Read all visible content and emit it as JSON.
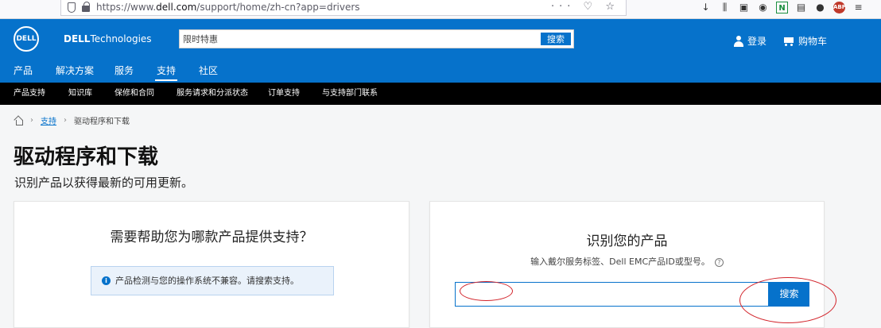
{
  "browser": {
    "url_prefix": "https://www.",
    "url_domain": "dell.com",
    "url_path": "/support/home/zh-cn?app=drivers",
    "url_tools": "··· ♡ ☆",
    "ext_n_label": "N",
    "ext_abp_label": "ABP"
  },
  "header": {
    "logo_text": "DELL",
    "brand_bold": "DELL",
    "brand_rest": "Technologies",
    "search_value": "限时特惠",
    "search_button": "搜索",
    "login": "登录",
    "cart": "购物车"
  },
  "nav_primary": [
    "产品",
    "解决方案",
    "服务",
    "支持",
    "社区"
  ],
  "nav_secondary": [
    "产品支持",
    "知识库",
    "保修和合同",
    "服务请求和分派状态",
    "订单支持",
    "与支持部门联系"
  ],
  "breadcrumb": {
    "support": "支持",
    "current": "驱动程序和下载"
  },
  "page": {
    "title": "驱动程序和下载",
    "subtitle": "识别产品以获得最新的可用更新。"
  },
  "left_card": {
    "title": "需要帮助您为哪款产品提供支持？",
    "notice": "产品检测与您的操作系统不兼容。请搜索支持。"
  },
  "right_card": {
    "title": "识别您的产品",
    "hint": "输入戴尔服务标签、Dell EMC产品ID或型号。",
    "input_value": "",
    "button": "搜索"
  },
  "colors": {
    "brand_blue": "#0672cb",
    "annotation_red": "#d2232a"
  }
}
